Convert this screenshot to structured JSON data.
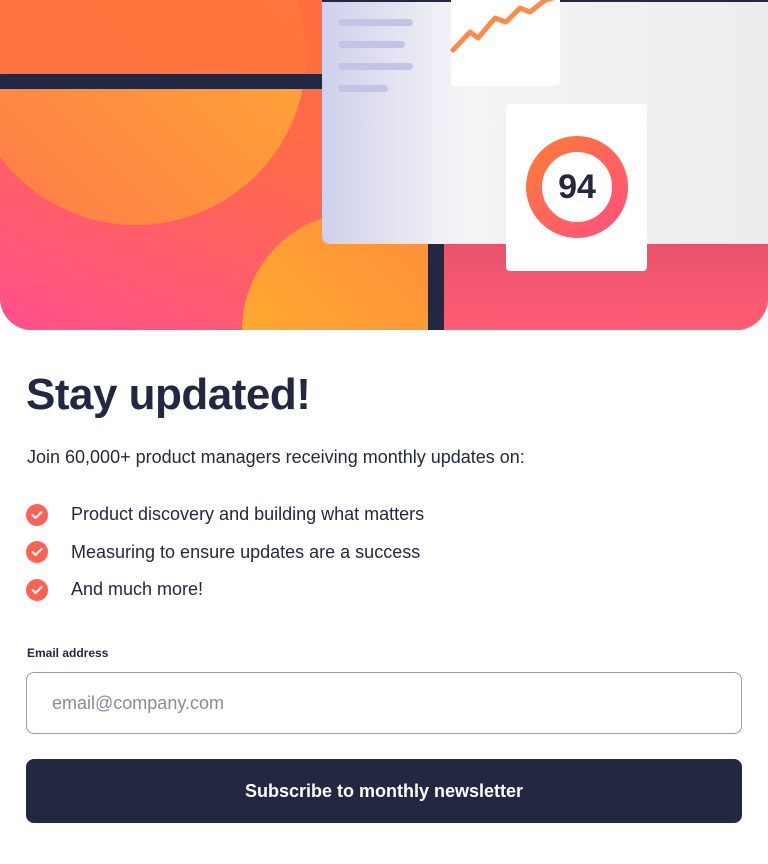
{
  "hero": {
    "score": "94"
  },
  "heading": "Stay updated!",
  "intro": "Join 60,000+ product managers receiving monthly updates on:",
  "features": [
    "Product discovery and building what matters",
    "Measuring to ensure updates are a success",
    "And much more!"
  ],
  "form": {
    "email_label": "Email address",
    "email_placeholder": "email@company.com",
    "email_value": "",
    "submit_label": "Subscribe to monthly newsletter"
  },
  "colors": {
    "primary_dark": "#242742",
    "accent_tomato": "#ff6155",
    "hero_gradient_start": "#ff527b",
    "hero_gradient_end": "#ff6a3a",
    "hero_highlight": "#ffb330",
    "border_grey": "#9b9ba8"
  },
  "icons": {
    "feature_bullet": "check-circle-icon"
  }
}
